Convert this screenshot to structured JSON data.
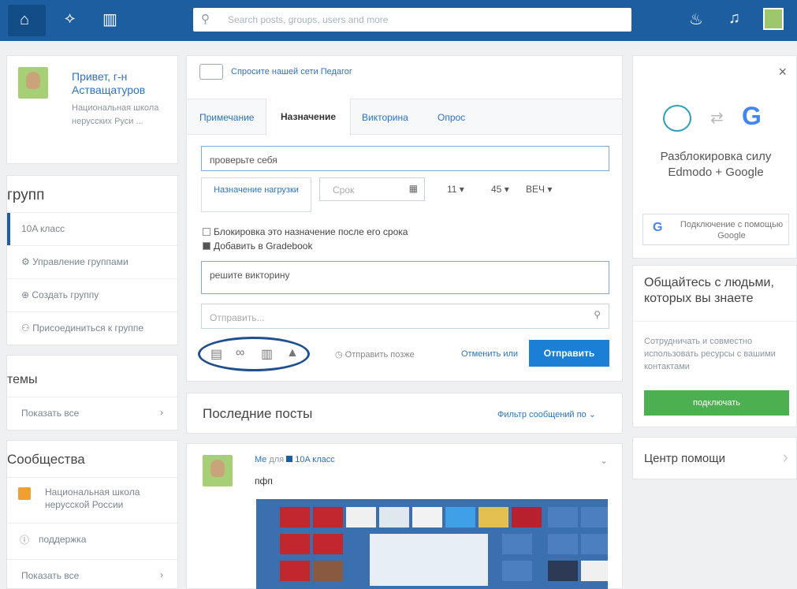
{
  "search": {
    "placeholder": "Search posts, groups, users and more"
  },
  "topbar": {
    "icons": [
      "home-icon",
      "activity-icon",
      "library-icon",
      "backpack-icon",
      "bell-icon",
      "profile-avatar"
    ]
  },
  "profile": {
    "greeting": "Привет, г-н Астващатуров",
    "school": "Национальная школа нерусских Руси ..."
  },
  "groups": {
    "title": "групп",
    "items": [
      "10A класс",
      "Управление группами",
      "Создать группу",
      "Присоединиться к группе"
    ]
  },
  "topics": {
    "title": "темы",
    "show_all": "Показать все"
  },
  "communities": {
    "title": "Сообщества",
    "items": [
      "Национальная школа нерусской России",
      "поддержка"
    ],
    "show_all": "Показать все"
  },
  "composer": {
    "ask_link": "Спросите нашей сети Педагог",
    "tabs": [
      "Примечание",
      "Назначение",
      "Викторина",
      "Опрос"
    ],
    "active_tab": "Назначение",
    "title_value": "проверьте себя",
    "assign_load_button": "Назначение нагрузки",
    "due_placeholder": "Срок",
    "hour": "11",
    "minute": "45",
    "ampm": "ВЕЧ",
    "lock_option": "Блокировка это назначение после его срока",
    "gradebook_option": "Добавить в Gradebook",
    "description_value": "решите викторину",
    "send_to_placeholder": "Отправить...",
    "schedule_later": "Отправить позже",
    "cancel_or": "Отменить или",
    "send_button": "Отправить"
  },
  "feed": {
    "title": "Последние посты",
    "filter": "Фильтр сообщений по",
    "post": {
      "author": "Me",
      "to": "для",
      "group": "10A класс",
      "text": "пфп"
    }
  },
  "right": {
    "close": "×",
    "unlock_title": "Разблокировка силу Edmodo + Google",
    "connect_google": "Подключение с помощью Google",
    "connect_title": "Общайтесь с людьми, которых вы знаете",
    "connect_desc": "Сотрудничать и совместно использовать ресурсы с вашими контактами",
    "connect_button": "подключать",
    "help": "Центр помощи"
  },
  "colors": {
    "topbar": "#1c5ea0",
    "primary": "#1c7fd6",
    "green": "#4caf50"
  }
}
